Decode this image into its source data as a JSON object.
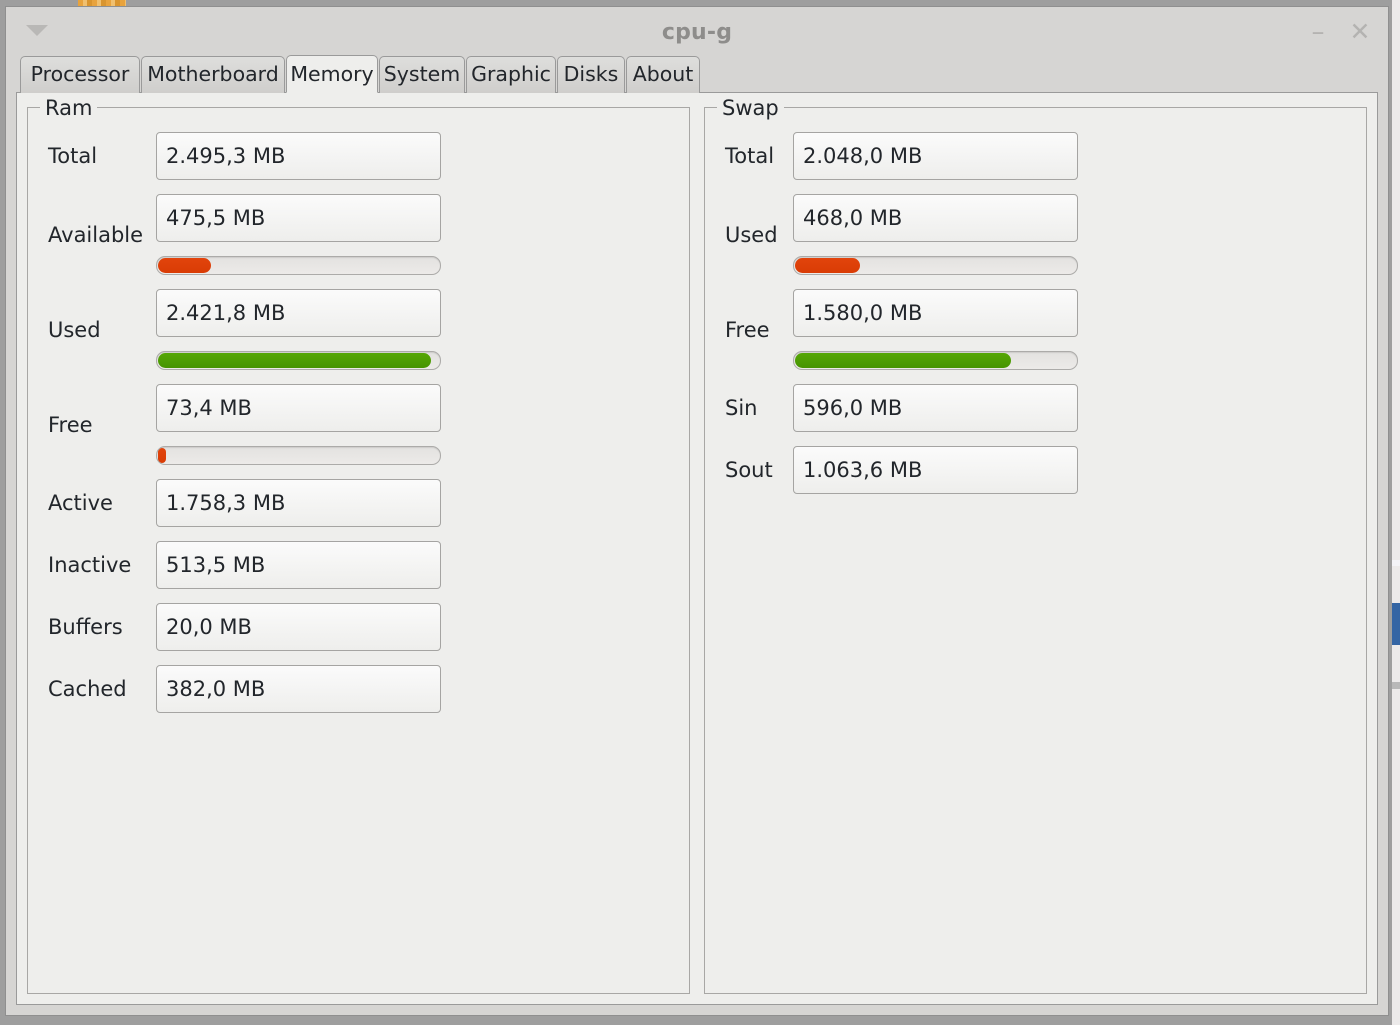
{
  "window": {
    "title": "cpu-g",
    "menu_icon": "menu-arrow-icon",
    "minimize_label": "–",
    "close_label": "✕"
  },
  "tabs": [
    {
      "label": "Processor",
      "active": false
    },
    {
      "label": "Motherboard",
      "active": false
    },
    {
      "label": "Memory",
      "active": true
    },
    {
      "label": "System",
      "active": false
    },
    {
      "label": "Graphic",
      "active": false
    },
    {
      "label": "Disks",
      "active": false
    },
    {
      "label": "About",
      "active": false
    }
  ],
  "colors": {
    "bar_red": "#dd3e05",
    "bar_green": "#4e9d04",
    "window_bg": "#d6d5d3",
    "page_bg": "#eeeeec",
    "text": "#22262b",
    "title_text": "#8e8d8b"
  },
  "ram": {
    "legend": "Ram",
    "rows": [
      {
        "label": "Total",
        "value": "2.495,3 MB",
        "bar": null
      },
      {
        "label": "Available",
        "value": "475,5 MB",
        "bar": {
          "percent": 19,
          "color": "red"
        }
      },
      {
        "label": "Used",
        "value": "2.421,8 MB",
        "bar": {
          "percent": 97,
          "color": "green"
        }
      },
      {
        "label": "Free",
        "value": "73,4 MB",
        "bar": {
          "percent": 3,
          "color": "red"
        }
      },
      {
        "label": "Active",
        "value": "1.758,3 MB",
        "bar": null
      },
      {
        "label": "Inactive",
        "value": "513,5 MB",
        "bar": null
      },
      {
        "label": "Buffers",
        "value": "20,0 MB",
        "bar": null
      },
      {
        "label": "Cached",
        "value": "382,0 MB",
        "bar": null
      }
    ]
  },
  "swap": {
    "legend": "Swap",
    "rows": [
      {
        "label": "Total",
        "value": "2.048,0 MB",
        "bar": null
      },
      {
        "label": "Used",
        "value": "468,0 MB",
        "bar": {
          "percent": 23,
          "color": "red"
        }
      },
      {
        "label": "Free",
        "value": "1.580,0 MB",
        "bar": {
          "percent": 77,
          "color": "green"
        }
      },
      {
        "label": "Sin",
        "value": "596,0 MB",
        "bar": null
      },
      {
        "label": "Sout",
        "value": "1.063,6 MB",
        "bar": null
      }
    ]
  }
}
